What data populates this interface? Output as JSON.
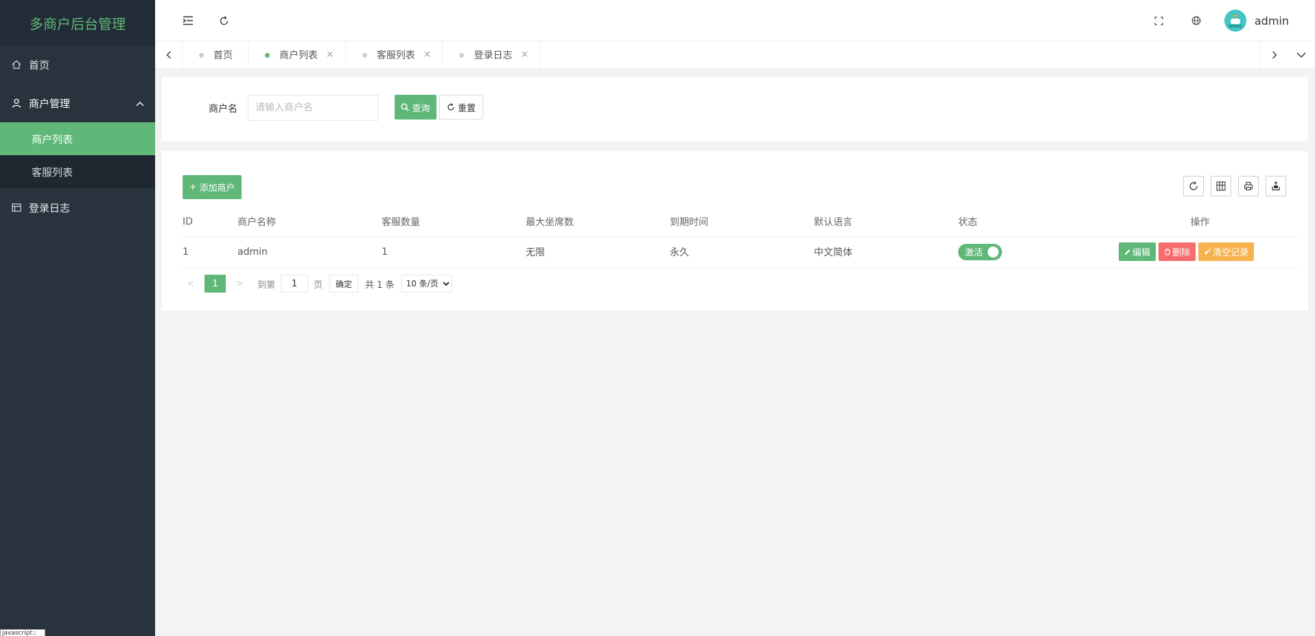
{
  "sidebar": {
    "logo": "多商户后台管理",
    "items": [
      {
        "label": "首页"
      },
      {
        "label": "商户管理",
        "children": [
          {
            "label": "商户列表"
          },
          {
            "label": "客服列表"
          }
        ]
      },
      {
        "label": "登录日志"
      }
    ],
    "status_fragment": "javascript:;"
  },
  "header": {
    "username": "admin"
  },
  "tabs": [
    {
      "label": "首页"
    },
    {
      "label": "商户列表"
    },
    {
      "label": "客服列表"
    },
    {
      "label": "登录日志"
    }
  ],
  "search": {
    "label": "商户名",
    "placeholder": "请输入商户名",
    "query_label": "查询",
    "reset_label": "重置"
  },
  "table": {
    "add_label": "添加商户",
    "columns": [
      "ID",
      "商户名称",
      "客服数量",
      "最大坐席数",
      "到期时间",
      "默认语言",
      "状态",
      "操作"
    ],
    "rows": [
      {
        "id": "1",
        "name": "admin",
        "service_count": "1",
        "max_seats": "无限",
        "expire": "永久",
        "language": "中文简体",
        "status": "激活"
      }
    ],
    "actions": {
      "edit": "编辑",
      "delete": "删除",
      "clear": "清空记录"
    }
  },
  "pager": {
    "current": "1",
    "goto_label": "到第",
    "page_value": "1",
    "page_unit": "页",
    "confirm_label": "确定",
    "total_label": "共 1 条",
    "page_size": "10 条/页"
  },
  "colors": {
    "accent": "#5fb878",
    "sidebar_bg": "#28333e",
    "danger": "#f56c6c",
    "warning": "#f7b24e"
  }
}
